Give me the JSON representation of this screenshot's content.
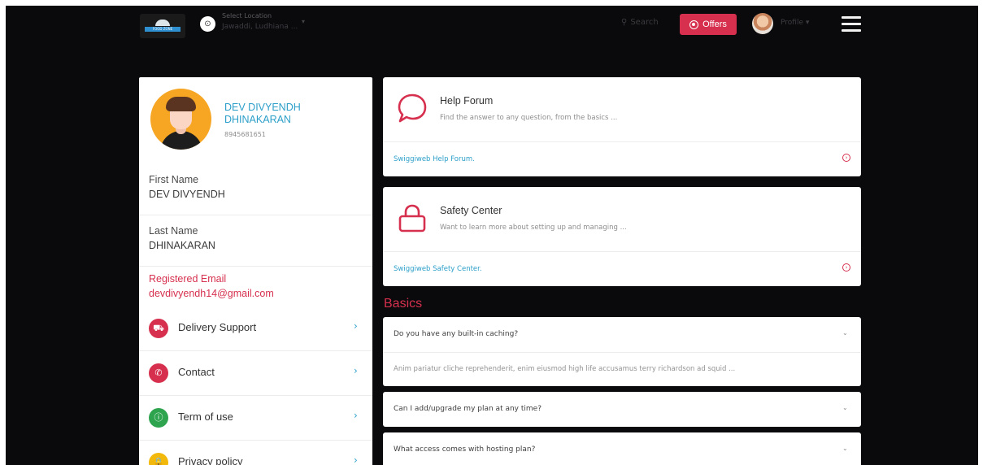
{
  "header": {
    "logo_text": "FOOD ZONE",
    "location_label": "Select Location",
    "location_value": "Jawaddi, Ludhiana ...",
    "search_label": "Search",
    "offers_label": "Offers",
    "profile_label": "Profile"
  },
  "profile": {
    "name": "DEV DIVYENDH DHINAKARAN",
    "phone": "8945681651",
    "fields": [
      {
        "label": "First Name",
        "value": "DEV DIVYENDH"
      },
      {
        "label": "Last Name",
        "value": "DHINAKARAN"
      },
      {
        "label": "Registered Email",
        "value": "devdivyendh14@gmail.com"
      }
    ],
    "menu": [
      {
        "label": "Delivery Support",
        "icon": "truck-icon",
        "color": "#d6304e"
      },
      {
        "label": "Contact",
        "icon": "phone-icon",
        "color": "#d6304e"
      },
      {
        "label": "Term of use",
        "icon": "info-icon",
        "color": "#2ea44f"
      },
      {
        "label": "Privacy policy",
        "icon": "lock-icon",
        "color": "#f2b90c"
      }
    ]
  },
  "help_forum": {
    "title": "Help Forum",
    "description": "Find the answer to any question, from the basics ...",
    "link": "Swiggiweb Help Forum."
  },
  "safety_center": {
    "title": "Safety Center",
    "description": "Want to learn more about setting up and managing ...",
    "link": "Swiggiweb Safety Center."
  },
  "basics": {
    "title": "Basics",
    "faqs": [
      {
        "question": "Do you have any built-in caching?",
        "answer": "Anim pariatur cliche reprehenderit, enim eiusmod high life accusamus terry richardson ad squid ..."
      },
      {
        "question": "Can I add/upgrade my plan at any time?",
        "answer": ""
      },
      {
        "question": "What access comes with hosting plan?",
        "answer": ""
      }
    ]
  },
  "colors": {
    "accent": "#d6304e",
    "link": "#2c9fc9",
    "background": "#0a0a0d"
  }
}
